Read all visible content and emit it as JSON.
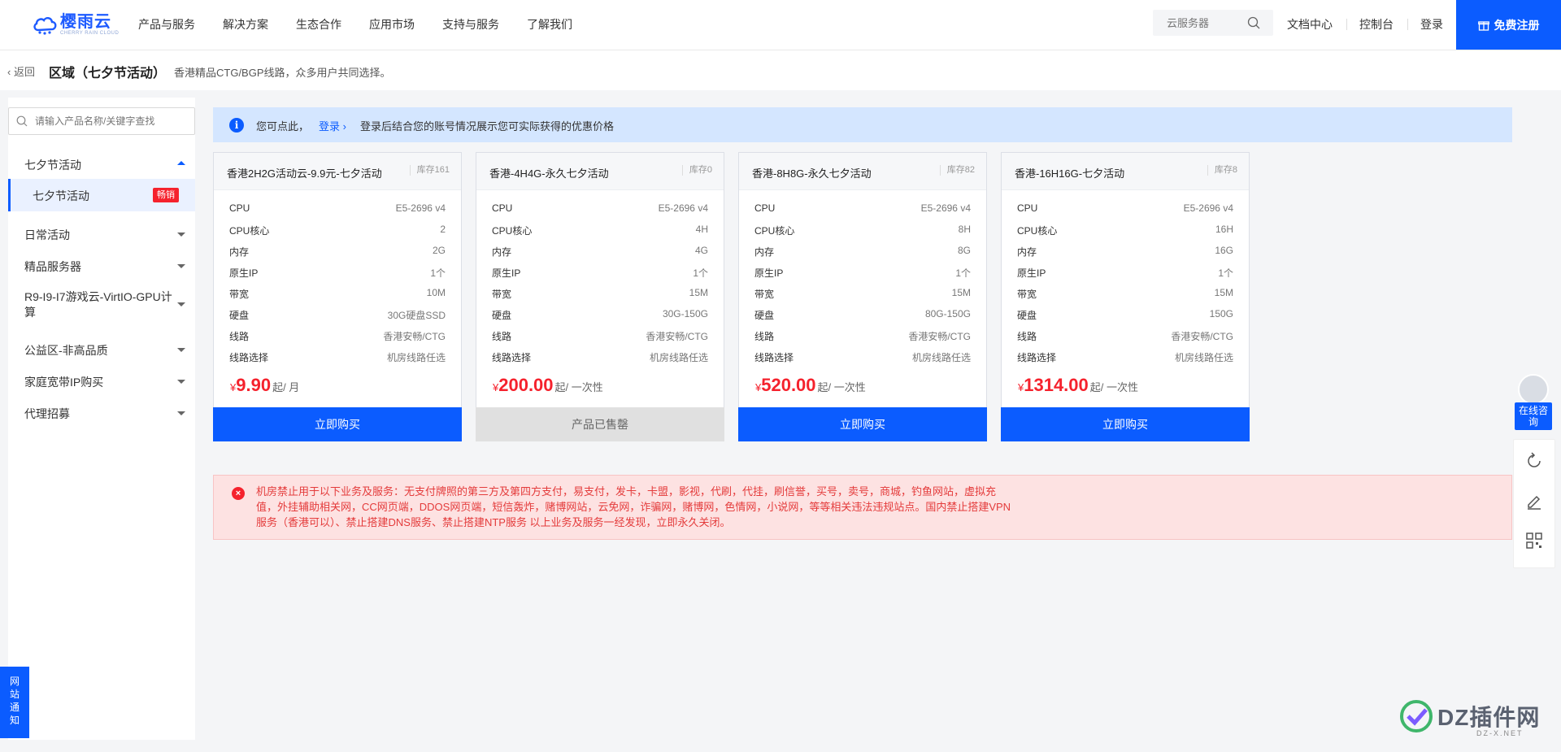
{
  "header": {
    "logo_title": "樱雨云",
    "logo_sub": "CHERRY RAIN CLOUD",
    "nav": [
      "产品与服务",
      "解决方案",
      "生态合作",
      "应用市场",
      "支持与服务",
      "了解我们"
    ],
    "search_placeholder": "云服务器",
    "docs": "文档中心",
    "console": "控制台",
    "login": "登录",
    "register": "免费注册"
  },
  "crumb": {
    "back": "返回",
    "title": "区域（七夕节活动）",
    "subtitle": "香港精品CTG/BGP线路，众多用户共同选择。"
  },
  "sidebar": {
    "search_placeholder": "请输入产品名称/关键字查找",
    "categories": [
      {
        "label": "七夕节活动"
      },
      {
        "label": "日常活动"
      },
      {
        "label": "精品服务器"
      },
      {
        "label": "R9-I9-I7游戏云-VirtIO-GPU计算"
      },
      {
        "label": "公益区-非高品质"
      },
      {
        "label": "家庭宽带IP购买"
      },
      {
        "label": "代理招募"
      }
    ],
    "active_sub": {
      "label": "七夕节活动",
      "badge": "畅销"
    }
  },
  "notice": {
    "prefix": "您可点此，",
    "link": "登录",
    "suffix": "登录后结合您的账号情况展示您可实际获得的优惠价格"
  },
  "spec_keys": [
    "CPU",
    "CPU核心",
    "内存",
    "原生IP",
    "带宽",
    "硬盘",
    "线路",
    "线路选择"
  ],
  "products": [
    {
      "title": "香港2H2G活动云-9.9元-七夕活动",
      "stock": "库存161",
      "specs": [
        "E5-2696 v4",
        "2",
        "2G",
        "1个",
        "10M",
        "30G硬盘SSD",
        "香港安畅/CTG",
        "机房线路任选"
      ],
      "currency": "¥",
      "price": "9.90",
      "unit": "起/ 月",
      "button": "立即购买",
      "sold_out": false
    },
    {
      "title": "香港-4H4G-永久七夕活动",
      "stock": "库存0",
      "specs": [
        "E5-2696 v4",
        "4H",
        "4G",
        "1个",
        "15M",
        "30G-150G",
        "香港安畅/CTG",
        "机房线路任选"
      ],
      "currency": "¥",
      "price": "200.00",
      "unit": "起/ 一次性",
      "button": "产品已售罄",
      "sold_out": true
    },
    {
      "title": "香港-8H8G-永久七夕活动",
      "stock": "库存82",
      "specs": [
        "E5-2696 v4",
        "8H",
        "8G",
        "1个",
        "15M",
        "80G-150G",
        "香港安畅/CTG",
        "机房线路任选"
      ],
      "currency": "¥",
      "price": "520.00",
      "unit": "起/ 一次性",
      "button": "立即购买",
      "sold_out": false
    },
    {
      "title": "香港-16H16G-七夕活动",
      "stock": "库存8",
      "specs": [
        "E5-2696 v4",
        "16H",
        "16G",
        "1个",
        "15M",
        "150G",
        "香港安畅/CTG",
        "机房线路任选"
      ],
      "currency": "¥",
      "price": "1314.00",
      "unit": "起/ 一次性",
      "button": "立即购买",
      "sold_out": false
    }
  ],
  "warning": "机房禁止用于以下业务及服务：无支付牌照的第三方及第四方支付，易支付，发卡，卡盟，影视，代刷，代挂，刷信誉，买号，卖号，商城，钓鱼网站，虚拟充值，外挂辅助相关网，CC网页端，DDOS网页端，短信轰炸，赌博网站，云免网，诈骗网，赌博网，色情网，小说网，等等相关违法违规站点。国内禁止搭建VPN服务（香港可以）、禁止搭建DNS服务、禁止搭建NTP服务 以上业务及服务一经发现，立即永久关闭。",
  "float": {
    "consult": "在线咨询",
    "tools": [
      "refresh-icon",
      "edit-icon",
      "qrcode-icon"
    ]
  },
  "site_notice": "网站通知",
  "watermark": {
    "text": "DZ插件网",
    "url": "DZ-X.NET"
  },
  "colors": {
    "primary": "#0b5cff",
    "price": "#f5222d",
    "notice_bg": "#d4e6ff",
    "warning_bg": "#fde2e2"
  }
}
